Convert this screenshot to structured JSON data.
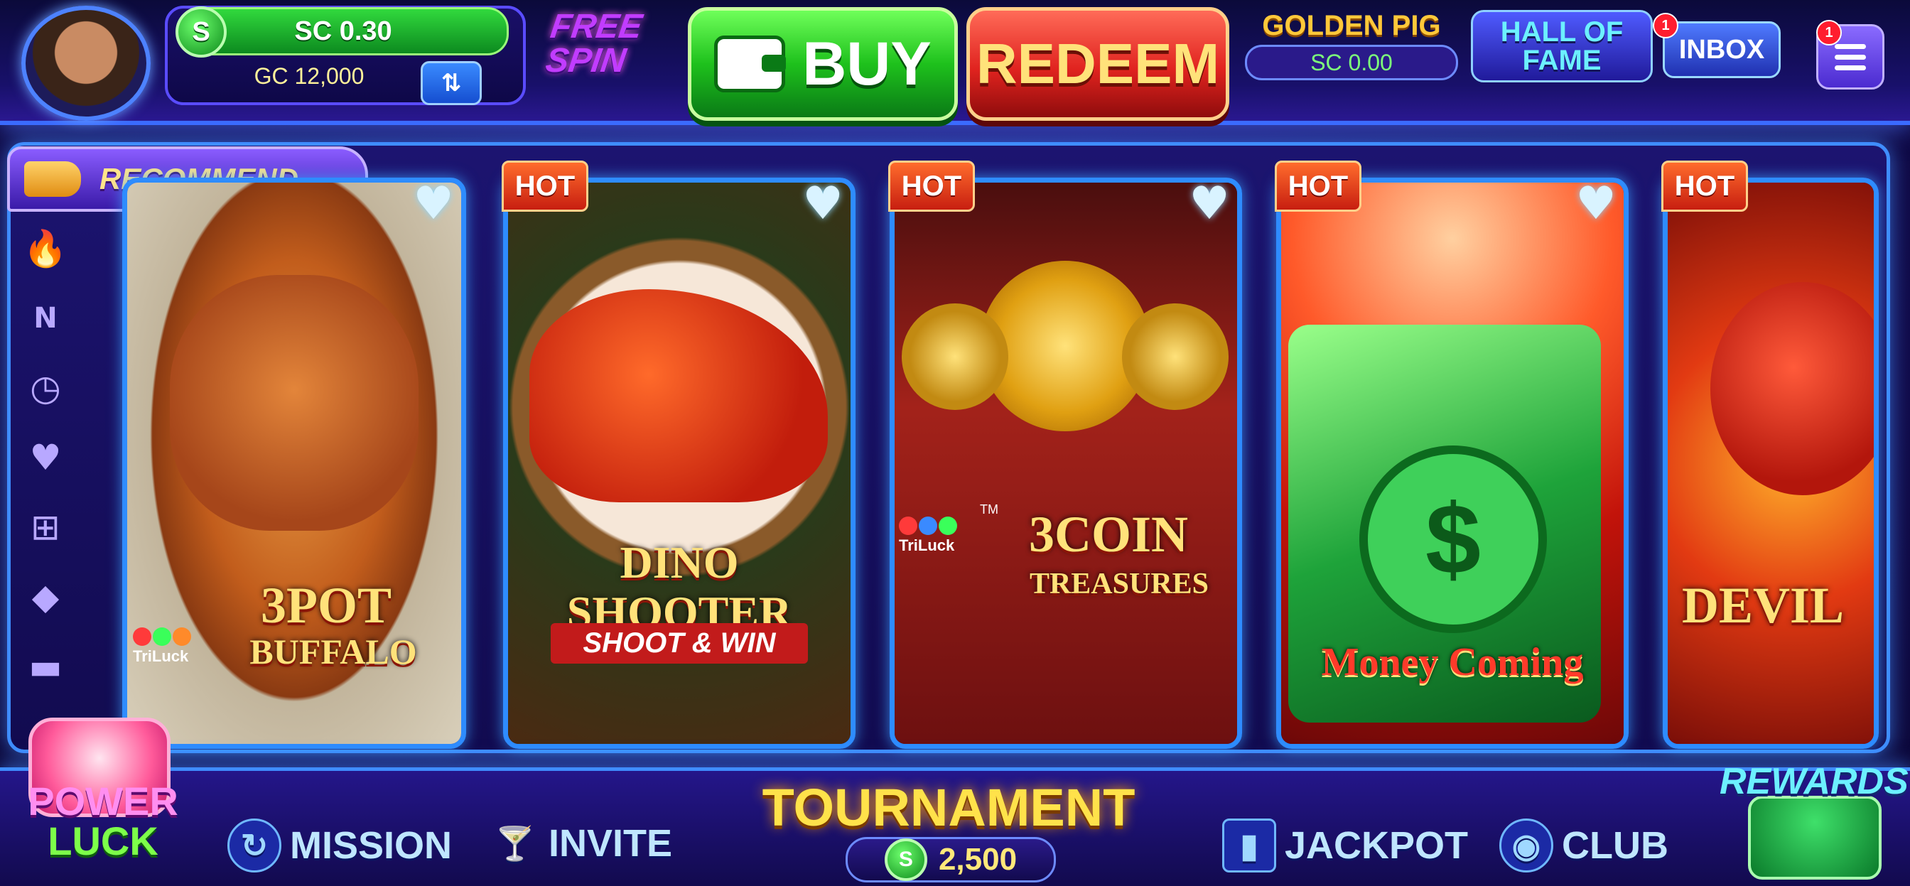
{
  "header": {
    "sc_balance": "SC 0.30",
    "gc_balance": "GC 12,000",
    "free_spin": "FREE SPIN",
    "buy_label": "BUY",
    "redeem_label": "REDEEM",
    "golden_pig": {
      "title": "GOLDEN PIG",
      "value": "SC 0.00"
    },
    "hall_of_fame": "HALL OF FAME",
    "inbox": {
      "label": "INBOX",
      "badge": "1"
    },
    "menu_badge": "1",
    "coin_symbol": "S",
    "swap_glyph": "⇅"
  },
  "recommend_label": "RECOMMEND",
  "side_rail_icons": [
    "flame-icon",
    "new-icon",
    "clock-icon",
    "heart-icon",
    "gift-icon",
    "diamond-icon",
    "hat-icon"
  ],
  "side_rail_glyphs": {
    "flame": "🔥",
    "new": "N",
    "clock": "◷",
    "heart": "♥",
    "gift": "⊞",
    "diamond": "◆",
    "hat": "▬"
  },
  "games": [
    {
      "title": "3POT",
      "title2": "BUFFALO",
      "brand": "TriLuck",
      "hot": "",
      "fav": "♥"
    },
    {
      "title": "DINO SHOOTER",
      "subtitle": "SHOOT & WIN",
      "hot": "HOT",
      "fav": "♥"
    },
    {
      "title": "3COIN",
      "title2": "TREASURES",
      "brand": "TriLuck",
      "tm": "TM",
      "hot": "HOT",
      "fav": "♥"
    },
    {
      "title": "Money Coming",
      "hot": "HOT",
      "fav": "♥"
    },
    {
      "title": "DEVIL",
      "hot": "HOT"
    }
  ],
  "bottom_nav": {
    "power_luck": {
      "line1": "POWER",
      "line2": "LUCK"
    },
    "mission": "MISSION",
    "invite": "INVITE",
    "tournament": {
      "label": "TOURNAMENT",
      "prize": "2,500"
    },
    "jackpot": "JACKPOT",
    "club": "CLUB",
    "rewards": "REWARDS"
  },
  "colors": {
    "accent_blue": "#3f8dff",
    "buy_green": "#1ec11c",
    "redeem_red": "#e0231f",
    "gold": "#ffe27a"
  }
}
